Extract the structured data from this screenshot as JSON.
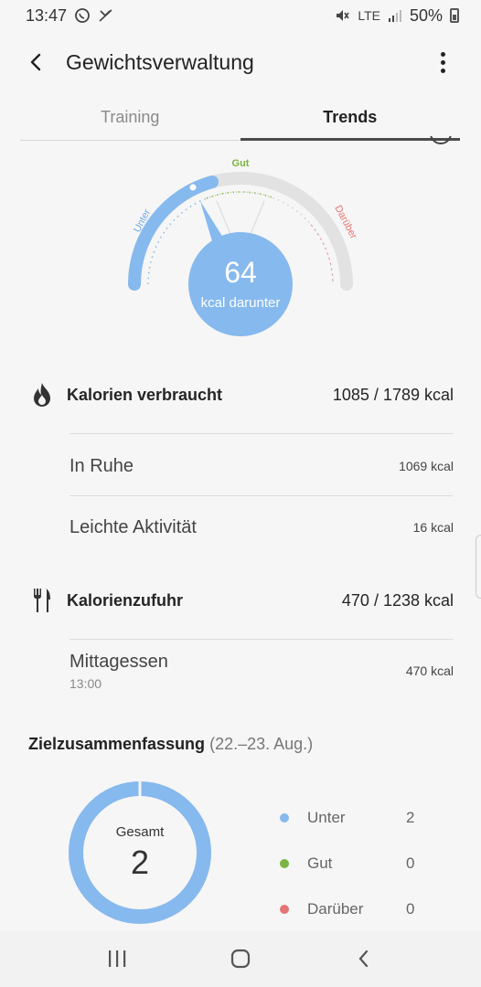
{
  "status_bar": {
    "time": "13:47",
    "battery": "50%",
    "network": "LTE",
    "icons": [
      "whatsapp-icon",
      "missed-call-icon",
      "mute-icon",
      "signal-icon",
      "battery-icon"
    ]
  },
  "app_bar": {
    "title": "Gewichtsverwaltung",
    "back_icon": "arrow-back-icon",
    "menu_icon": "more-vert-icon"
  },
  "tabs": [
    {
      "label": "Training",
      "active": false
    },
    {
      "label": "Trends",
      "active": true
    }
  ],
  "gauge": {
    "value": "64",
    "label": "kcal darunter",
    "zone_under": "Unter",
    "zone_good": "Gut",
    "zone_over": "Darüber",
    "colors": {
      "under": "#86b9ee",
      "good": "#7cb342",
      "over": "#e57373",
      "track": "#e2e2e2"
    }
  },
  "burned": {
    "title": "Kalorien verbraucht",
    "value": "1085 / 1789 kcal",
    "icon": "flame-icon",
    "items": [
      {
        "label": "In Ruhe",
        "value": "1069 kcal"
      },
      {
        "label": "Leichte Aktivität",
        "value": "16 kcal"
      }
    ]
  },
  "intake": {
    "title": "Kalorienzufuhr",
    "value": "470 / 1238 kcal",
    "icon": "fork-knife-icon",
    "items": [
      {
        "label": "Mittagessen",
        "time": "13:00",
        "value": "470 kcal"
      }
    ]
  },
  "summary": {
    "title": "Zielzusammenfassung",
    "range": "(22.–23. Aug.)",
    "total_label": "Gesamt",
    "total_value": "2",
    "legend": [
      {
        "label": "Unter",
        "count": "2",
        "color": "#86b9ee"
      },
      {
        "label": "Gut",
        "count": "0",
        "color": "#7cb342"
      },
      {
        "label": "Darüber",
        "count": "0",
        "color": "#e57373"
      }
    ]
  },
  "nav_bar": {
    "icons": [
      "recents-icon",
      "home-icon",
      "back-icon"
    ]
  }
}
